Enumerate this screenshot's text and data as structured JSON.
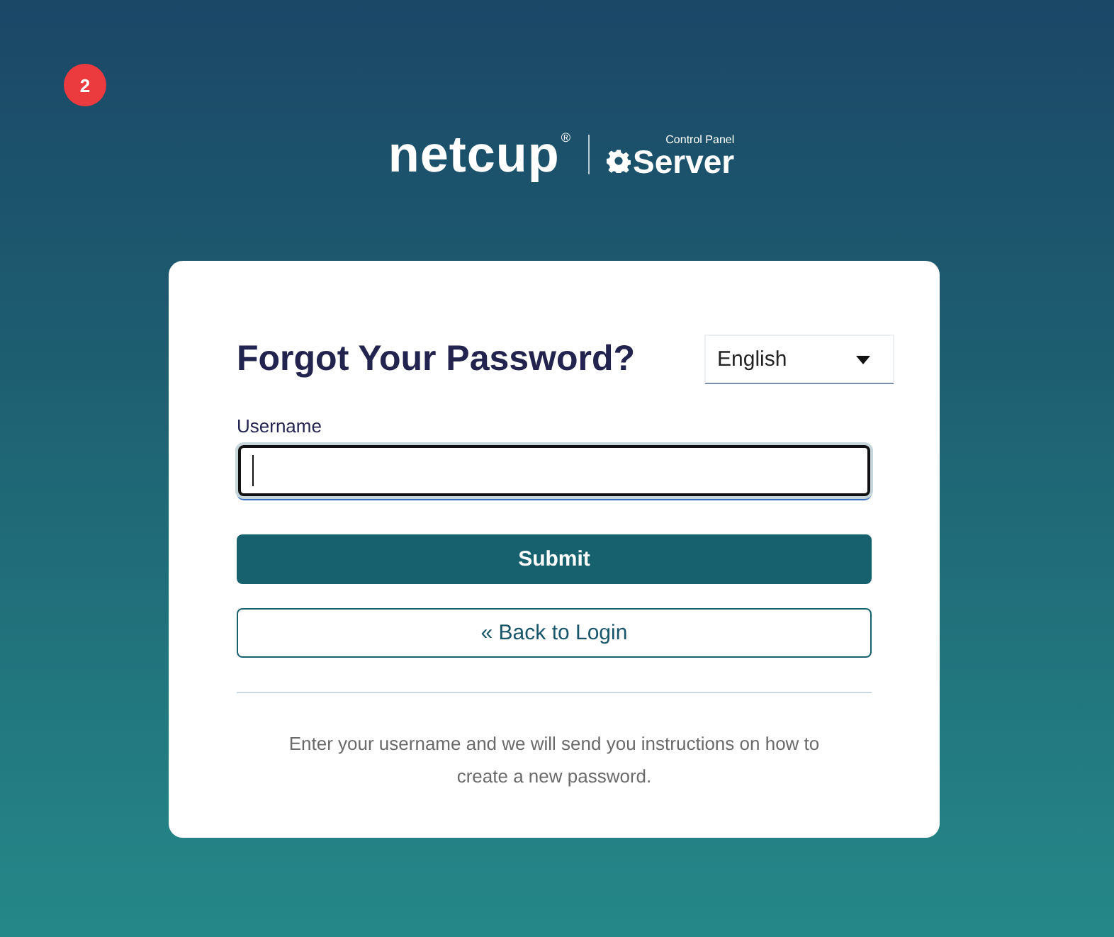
{
  "badge": "2",
  "logo": {
    "brand": "netcup",
    "registered": "®",
    "caption": "Control Panel",
    "product": "Server"
  },
  "card": {
    "title": "Forgot Your Password?",
    "language": {
      "value": "English"
    },
    "username": {
      "label": "Username",
      "focused": true
    },
    "buttons": [
      {
        "kind": "primary",
        "label": "Submit"
      },
      {
        "kind": "outline",
        "label": "« Back to Login"
      }
    ],
    "help_text": "Enter your username and we will send you instructions on how to create a new password."
  }
}
